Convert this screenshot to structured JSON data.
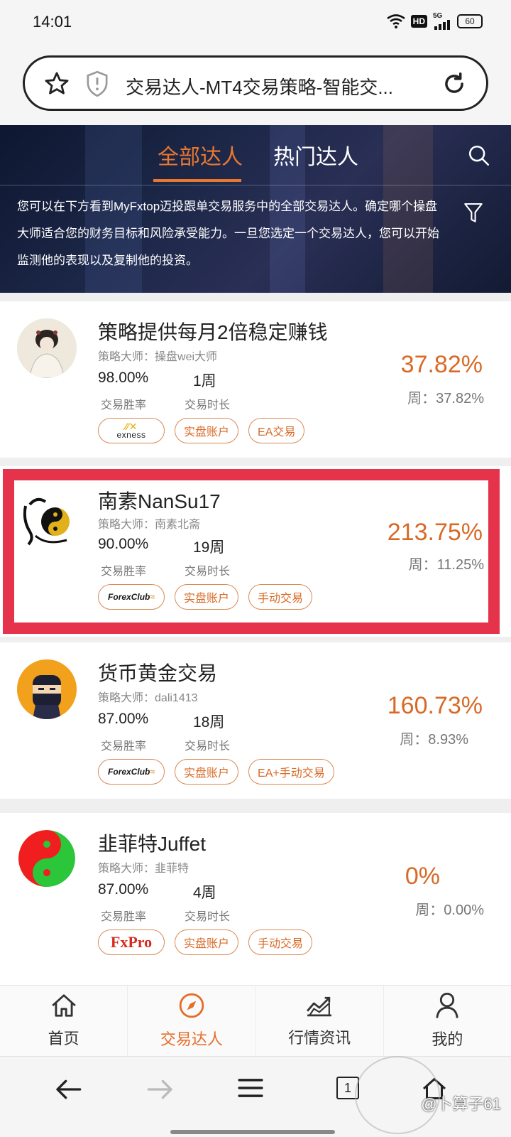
{
  "status_bar": {
    "time": "14:01",
    "network": "5G",
    "hd": "HD",
    "battery": "60"
  },
  "browser": {
    "url_title": "交易达人-MT4交易策略-智能交...",
    "tab_count": "1"
  },
  "hero": {
    "tabs": [
      {
        "label": "全部达人",
        "active": true
      },
      {
        "label": "热门达人",
        "active": false
      }
    ],
    "description": "您可以在下方看到MyFxtop迈投跟单交易服务中的全部交易达人。确定哪个操盘大师适合您的财务目标和风险承受能力。一旦您选定一个交易达人，您可以开始监测他的表现以及复制他的投资。"
  },
  "traders": [
    {
      "title": "策略提供每月2倍稳定赚钱",
      "master_prefix": "策略大师：",
      "master": "操盘wei大师",
      "win_rate": "98.00%",
      "win_rate_label": "交易胜率",
      "duration": "1周",
      "duration_label": "交易时长",
      "return": "37.82%",
      "week_prefix": "周：",
      "week": "37.82%",
      "broker": "exness",
      "tags": [
        "实盘账户",
        "EA交易"
      ],
      "avatar_icon": "woman-portrait-icon"
    },
    {
      "title": "南素NanSu17",
      "master_prefix": "策略大师：",
      "master": "南素北斋",
      "win_rate": "90.00%",
      "win_rate_label": "交易胜率",
      "duration": "19周",
      "duration_label": "交易时长",
      "return": "213.75%",
      "week_prefix": "周：",
      "week": "11.25%",
      "broker": "ForexClub",
      "tags": [
        "实盘账户",
        "手动交易"
      ],
      "avatar_icon": "yin-yang-dragon-icon"
    },
    {
      "title": "货币黄金交易",
      "master_prefix": "策略大师：",
      "master": "dali1413",
      "win_rate": "87.00%",
      "win_rate_label": "交易胜率",
      "duration": "18周",
      "duration_label": "交易时长",
      "return": "160.73%",
      "week_prefix": "周：",
      "week": "8.93%",
      "broker": "ForexClub",
      "tags": [
        "实盘账户",
        "EA+手动交易"
      ],
      "avatar_icon": "ninja-icon"
    },
    {
      "title": "韭菲特Juffet",
      "master_prefix": "策略大师：",
      "master": "韭菲特",
      "win_rate": "87.00%",
      "win_rate_label": "交易胜率",
      "duration": "4周",
      "duration_label": "交易时长",
      "return": "0%",
      "week_prefix": "周：",
      "week": "0.00%",
      "broker": "FxPro",
      "tags": [
        "实盘账户",
        "手动交易"
      ],
      "avatar_icon": "red-green-yin-yang-icon"
    }
  ],
  "bottom_nav": [
    {
      "label": "首页",
      "icon": "home-icon",
      "active": false
    },
    {
      "label": "交易达人",
      "icon": "compass-icon",
      "active": true
    },
    {
      "label": "行情资讯",
      "icon": "chart-icon",
      "active": false
    },
    {
      "label": "我的",
      "icon": "user-icon",
      "active": false
    }
  ],
  "watermark": "@卜算子61",
  "colors": {
    "accent": "#e9782f",
    "return_color": "#d86a26",
    "highlight": "#e4334a",
    "hero_bg": "#1c2748"
  }
}
